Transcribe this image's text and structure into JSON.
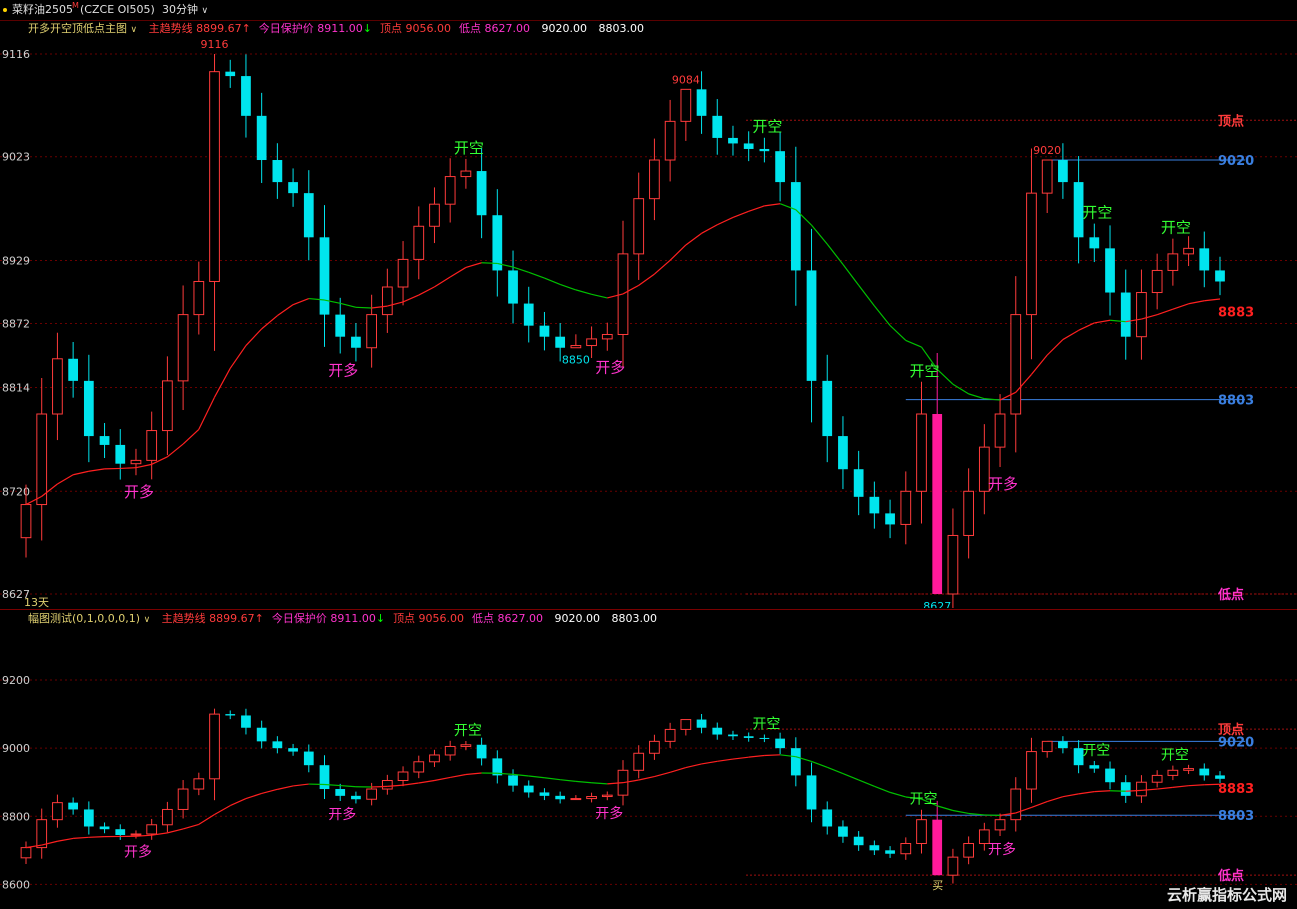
{
  "header": {
    "symbol": "菜籽油2505",
    "symbol_badge": "M",
    "code": "(CZCE OI505)",
    "period": "30分钟",
    "period_caret": "∨"
  },
  "panel1": {
    "indicator": "开多开空顶低点主图",
    "caret": "∨",
    "fields": [
      {
        "label": "主趋势线",
        "value": "8899.67",
        "arrow": "↑",
        "color": "#ff3b3b",
        "vcolor": "#ff3b3b",
        "acolor": "#ff3b3b"
      },
      {
        "label": "今日保护价",
        "value": "8911.00",
        "arrow": "↓",
        "color": "#ff33cc",
        "vcolor": "#ff33cc",
        "acolor": "#00ff00"
      },
      {
        "label": "顶点",
        "value": "9056.00",
        "color": "#ff3b3b",
        "vcolor": "#ff3b3b"
      },
      {
        "label": "低点",
        "value": "8627.00",
        "color": "#ff33cc",
        "vcolor": "#ff33cc"
      },
      {
        "label": "",
        "value": "9020.00",
        "color": "#ffffff",
        "vcolor": "#ffffff"
      },
      {
        "label": "",
        "value": "8803.00",
        "color": "#ffffff",
        "vcolor": "#ffffff"
      }
    ],
    "days_label": "13天"
  },
  "panel2": {
    "indicator": "幅图测试(0,1,0,0,0,1)",
    "caret": "∨",
    "fields": [
      {
        "label": "主趋势线",
        "value": "8899.67",
        "arrow": "↑",
        "color": "#ff3b3b",
        "vcolor": "#ff3b3b",
        "acolor": "#ff3b3b"
      },
      {
        "label": "今日保护价",
        "value": "8911.00",
        "arrow": "↓",
        "color": "#ff33cc",
        "vcolor": "#ff33cc",
        "acolor": "#00ff00"
      },
      {
        "label": "顶点",
        "value": "9056.00",
        "color": "#ff3b3b",
        "vcolor": "#ff3b3b"
      },
      {
        "label": "低点",
        "value": "8627.00",
        "color": "#ff33cc",
        "vcolor": "#ff33cc"
      },
      {
        "label": "",
        "value": "9020.00",
        "color": "#ffffff",
        "vcolor": "#ffffff"
      },
      {
        "label": "",
        "value": "8803.00",
        "color": "#ffffff",
        "vcolor": "#ffffff"
      }
    ]
  },
  "colors": {
    "up": "#ff3b3b",
    "down": "#00e5ee",
    "trend_up": "#ff2020",
    "trend_down": "#00c000",
    "grid": "#6a0000",
    "buy_label": "#ff33cc",
    "sell_label": "#33ff33",
    "blue_line": "#3a7fe0"
  },
  "watermark": "云析赢指标公式网",
  "chart_data": [
    {
      "type": "candlestick",
      "name": "main",
      "y_tick_labels": [
        "9116",
        "9023",
        "8929",
        "8872",
        "8814",
        "8720",
        "8627"
      ],
      "y_ticks": [
        9116,
        9023,
        8929,
        8872,
        8814,
        8720,
        8627
      ],
      "ylim": [
        8627,
        9116
      ],
      "ohlc": [],
      "trend_line": [],
      "peak_labels": [
        {
          "i": 12,
          "value": "9116",
          "price": 9116
        },
        {
          "i": 42,
          "value": "9084",
          "price": 9084
        },
        {
          "i": 65,
          "value": "9020",
          "price": 9020
        }
      ],
      "trough_labels": [
        {
          "i": 35,
          "value": "8850",
          "price": 8850
        },
        {
          "i": 58,
          "value": "8627",
          "price": 8627
        }
      ],
      "buy_signals": [
        {
          "i": 7,
          "text": "开多"
        },
        {
          "i": 20,
          "text": "开多"
        },
        {
          "i": 37,
          "text": "开多"
        },
        {
          "i": 62,
          "text": "开多"
        }
      ],
      "sell_signals": [
        {
          "i": 28,
          "text": "开空"
        },
        {
          "i": 47,
          "text": "开空"
        },
        {
          "i": 57,
          "text": "开空"
        },
        {
          "i": 68,
          "text": "开空"
        },
        {
          "i": 73,
          "text": "开空"
        }
      ],
      "hlines": [
        {
          "price": 9056,
          "label": "顶点",
          "color": "#ff3b3b",
          "style": "dashed"
        },
        {
          "price": 9020,
          "label": "9020",
          "color": "#3a7fe0",
          "style": "solid"
        },
        {
          "price": 8883,
          "label": "8883",
          "color": "#ff2020",
          "style": "none"
        },
        {
          "price": 8803,
          "label": "8803",
          "color": "#3a7fe0",
          "style": "solid"
        },
        {
          "price": 8627,
          "label": "低点",
          "color": "#ff33cc",
          "style": "dashed"
        }
      ]
    },
    {
      "type": "candlestick",
      "name": "sub",
      "y_tick_labels": [
        "9200",
        "9000",
        "8800",
        "8600"
      ],
      "y_ticks": [
        9200,
        9000,
        8800,
        8600
      ],
      "ylim": [
        8560,
        9300
      ],
      "buy_signals": [
        {
          "i": 7,
          "text": "开多"
        },
        {
          "i": 20,
          "text": "开多"
        },
        {
          "i": 37,
          "text": "开多"
        },
        {
          "i": 62,
          "text": "开多"
        }
      ],
      "sell_signals": [
        {
          "i": 28,
          "text": "开空"
        },
        {
          "i": 47,
          "text": "开空"
        },
        {
          "i": 57,
          "text": "开空"
        },
        {
          "i": 68,
          "text": "开空"
        },
        {
          "i": 73,
          "text": "开空"
        }
      ],
      "buy_marker": {
        "i": 58,
        "text": "买"
      },
      "hlines": [
        {
          "price": 9056,
          "label": "顶点",
          "color": "#ff3b3b",
          "style": "dashed"
        },
        {
          "price": 9020,
          "label": "9020",
          "color": "#3a7fe0",
          "style": "solid"
        },
        {
          "price": 8883,
          "label": "8883",
          "color": "#ff2020",
          "style": "none"
        },
        {
          "price": 8803,
          "label": "8803",
          "color": "#3a7fe0",
          "style": "solid"
        },
        {
          "price": 8627,
          "label": "低点",
          "color": "#ff33cc",
          "style": "dashed"
        }
      ]
    }
  ]
}
